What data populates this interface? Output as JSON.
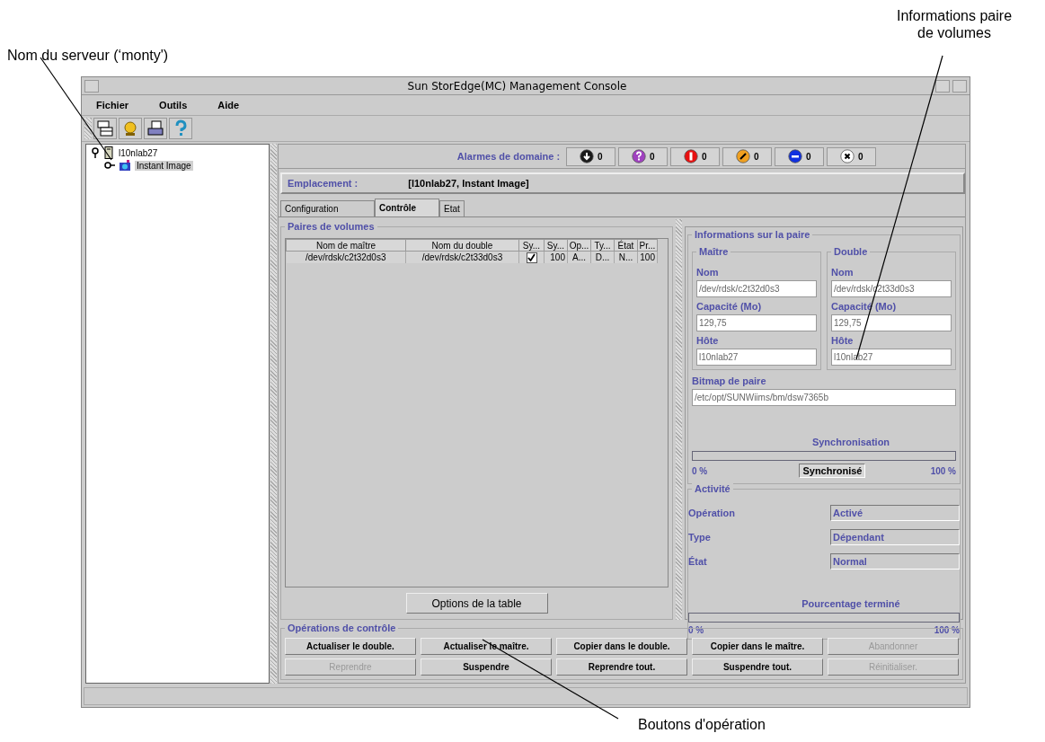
{
  "callouts": [
    {
      "kind": "server",
      "text": "Nom du serveur (‘monty')"
    },
    {
      "kind": "info",
      "text": "Informations paire de volumes"
    },
    {
      "kind": "buttons",
      "text": "Boutons d'opération"
    }
  ],
  "window": {
    "title": "Sun StorEdge(MC) Management Console"
  },
  "menus": [
    "Fichier",
    "Outils",
    "Aide"
  ],
  "toolbar": [
    {
      "kind": "layout"
    },
    {
      "kind": "alarm"
    },
    {
      "kind": "log"
    },
    {
      "kind": "help"
    }
  ],
  "tree": [
    {
      "label": "l10nlab27",
      "kind": "server",
      "selected": false,
      "expanded": true,
      "children": [
        {
          "label": "Instant Image",
          "kind": "module",
          "selected": true
        }
      ]
    }
  ],
  "alarms": {
    "label": "Alarmes de domaine :",
    "items": [
      {
        "kind": "down",
        "color": "#1a1a1a",
        "count": "0"
      },
      {
        "kind": "question",
        "color": "#a040c0",
        "count": "0"
      },
      {
        "kind": "critical",
        "color": "#e81010",
        "count": "0"
      },
      {
        "kind": "major",
        "color": "#f0a020",
        "count": "0"
      },
      {
        "kind": "minor",
        "color": "#1030e0",
        "count": "0"
      },
      {
        "kind": "error",
        "color": "#ffffff",
        "count": "0"
      }
    ]
  },
  "location": {
    "label": "Emplacement :",
    "value": "[l10nlab27, Instant Image]"
  },
  "tabs": [
    {
      "label": "Configuration",
      "selected": false
    },
    {
      "label": "Contrôle",
      "selected": true
    },
    {
      "label": "Etat",
      "selected": false
    }
  ],
  "volume_pairs": {
    "title": "Paires de volumes",
    "columns": [
      "Nom de maître",
      "Nom du double",
      "Sy...",
      "Sy...",
      "Op...",
      "Ty...",
      "État",
      "Pr..."
    ],
    "rows": [
      {
        "checked": true,
        "cells": [
          "/dev/rdsk/c2t32d0s3",
          "/dev/rdsk/c2t33d0s3",
          "",
          "100",
          "A...",
          "D...",
          "N...",
          "100"
        ]
      }
    ],
    "options_button": "Options de la table"
  },
  "pair_info": {
    "title": "Informations sur la paire",
    "groups": [
      {
        "title": "Maître",
        "fields": [
          {
            "label": "Nom",
            "value": "/dev/rdsk/c2t32d0s3"
          },
          {
            "label": "Capacité (Mo)",
            "value": "129,75"
          },
          {
            "label": "Hôte",
            "value": "l10nlab27"
          }
        ]
      },
      {
        "title": "Double",
        "fields": [
          {
            "label": "Nom",
            "value": "/dev/rdsk/c2t33d0s3"
          },
          {
            "label": "Capacité (Mo)",
            "value": "129,75"
          },
          {
            "label": "Hôte",
            "value": "l10nlab27"
          }
        ]
      }
    ],
    "bitmap": {
      "label": "Bitmap de paire",
      "value": "/etc/opt/SUNWiims/bm/dsw7365b"
    },
    "sync": {
      "label": "Synchronisation",
      "level": 0,
      "min": "0 %",
      "max": "100 %",
      "status": "Synchronisé"
    }
  },
  "activity": {
    "title": "Activité",
    "rows": [
      {
        "label": "Opération",
        "value": "Activé"
      },
      {
        "label": "Type",
        "value": "Dépendant"
      },
      {
        "label": "État",
        "value": "Normal"
      }
    ],
    "progress": {
      "label": "Pourcentage terminé",
      "level": 0,
      "min": "0 %",
      "max": "100 %"
    }
  },
  "operations": {
    "title": "Opérations de contrôle",
    "buttons": [
      {
        "label": "Actualiser le double.",
        "disabled": false
      },
      {
        "label": "Actualiser le maître.",
        "disabled": false
      },
      {
        "label": "Copier dans le double.",
        "disabled": false
      },
      {
        "label": "Copier dans le maître.",
        "disabled": false
      },
      {
        "label": "Abandonner",
        "disabled": true
      },
      {
        "label": "Reprendre",
        "disabled": true
      },
      {
        "label": "Suspendre",
        "disabled": false
      },
      {
        "label": "Reprendre tout.",
        "disabled": false
      },
      {
        "label": "Suspendre tout.",
        "disabled": false
      },
      {
        "label": "Réinitialiser.",
        "disabled": true
      }
    ]
  }
}
